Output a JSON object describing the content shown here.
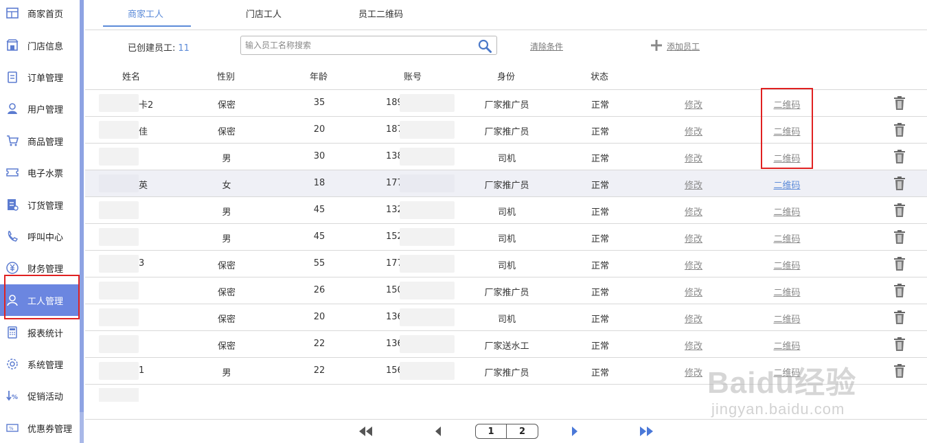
{
  "sidebar": {
    "items": [
      {
        "label": "商家首页",
        "icon": "home-grid-icon"
      },
      {
        "label": "门店信息",
        "icon": "store-icon"
      },
      {
        "label": "订单管理",
        "icon": "clipboard-icon"
      },
      {
        "label": "用户管理",
        "icon": "user-icon"
      },
      {
        "label": "商品管理",
        "icon": "cart-icon"
      },
      {
        "label": "电子水票",
        "icon": "ticket-icon"
      },
      {
        "label": "订货管理",
        "icon": "order-doc-icon"
      },
      {
        "label": "呼叫中心",
        "icon": "phone-icon"
      },
      {
        "label": "财务管理",
        "icon": "yen-icon"
      },
      {
        "label": "工人管理",
        "icon": "worker-icon",
        "active": true
      },
      {
        "label": "报表统计",
        "icon": "calculator-icon"
      },
      {
        "label": "系统管理",
        "icon": "gear-icon"
      },
      {
        "label": "促销活动",
        "icon": "discount-arrow-icon"
      },
      {
        "label": "优惠券管理",
        "icon": "coupon-icon"
      }
    ]
  },
  "tabs": [
    {
      "label": "商家工人",
      "active": true
    },
    {
      "label": "门店工人",
      "active": false
    },
    {
      "label": "员工二维码",
      "active": false
    }
  ],
  "toolbar": {
    "count_label": "已创建员工:",
    "count_value": "11",
    "search_placeholder": "输入员工名称搜索",
    "clear_label": "清除条件",
    "add_label": "添加员工"
  },
  "table": {
    "headers": [
      "姓名",
      "性别",
      "年龄",
      "账号",
      "身份",
      "状态"
    ],
    "rows": [
      {
        "name": "卡2",
        "gender": "保密",
        "age": "35",
        "account": "189",
        "role": "厂家推广员",
        "status": "正常",
        "edit": "修改",
        "qr": "二维码"
      },
      {
        "name": "佳",
        "gender": "保密",
        "age": "20",
        "account": "187",
        "role": "厂家推广员",
        "status": "正常",
        "edit": "修改",
        "qr": "二维码"
      },
      {
        "name": "",
        "gender": "男",
        "age": "30",
        "account": "138",
        "role": "司机",
        "status": "正常",
        "edit": "修改",
        "qr": "二维码"
      },
      {
        "name": "英",
        "gender": "女",
        "age": "18",
        "account": "177",
        "role": "厂家推广员",
        "status": "正常",
        "edit": "修改",
        "qr": "二维码",
        "highlight": true
      },
      {
        "name": "",
        "gender": "男",
        "age": "45",
        "account": "132",
        "role": "司机",
        "status": "正常",
        "edit": "修改",
        "qr": "二维码"
      },
      {
        "name": "",
        "gender": "男",
        "age": "45",
        "account": "152",
        "role": "司机",
        "status": "正常",
        "edit": "修改",
        "qr": "二维码"
      },
      {
        "name": "3",
        "gender": "保密",
        "age": "55",
        "account": "177",
        "role": "司机",
        "status": "正常",
        "edit": "修改",
        "qr": "二维码"
      },
      {
        "name": "",
        "gender": "保密",
        "age": "26",
        "account": "150",
        "role": "厂家推广员",
        "status": "正常",
        "edit": "修改",
        "qr": "二维码"
      },
      {
        "name": "",
        "gender": "保密",
        "age": "20",
        "account": "136",
        "role": "司机",
        "status": "正常",
        "edit": "修改",
        "qr": "二维码"
      },
      {
        "name": "",
        "gender": "保密",
        "age": "22",
        "account": "136",
        "role": "厂家送水工",
        "status": "正常",
        "edit": "修改",
        "qr": "二维码"
      },
      {
        "name": "1",
        "gender": "男",
        "age": "22",
        "account": "156",
        "role": "厂家推广员",
        "status": "正常",
        "edit": "修改",
        "qr": "二维码"
      }
    ]
  },
  "pager": {
    "pages": [
      "1",
      "2"
    ]
  },
  "watermark": {
    "main": "Baidu经验",
    "sub": "jingyan.baidu.com"
  },
  "colors": {
    "accent": "#5b8ad8",
    "active_nav": "#6b86e0",
    "highlight_box": "#e02020"
  }
}
